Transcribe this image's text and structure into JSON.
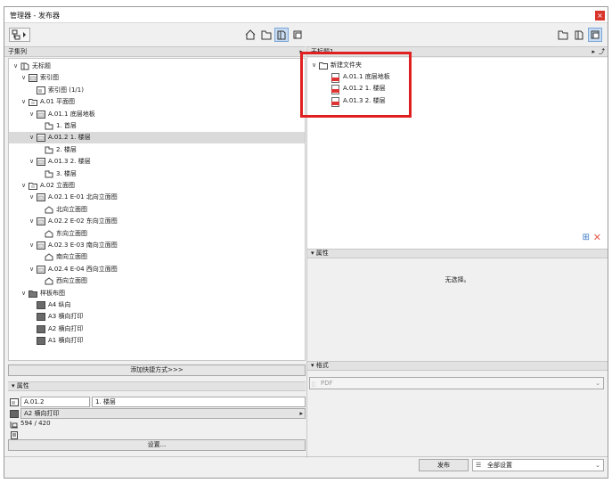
{
  "window": {
    "title": "管理器 - 发布器",
    "close_label": "×"
  },
  "left_panel": {
    "header": "子集列",
    "tree": [
      {
        "label": "无标题",
        "indent": 0,
        "chev": "∨",
        "icon": "book-icon",
        "selected": false
      },
      {
        "label": "索引图",
        "indent": 1,
        "chev": "∨",
        "icon": "view-icon",
        "selected": false
      },
      {
        "label": "索引图 (1/1)",
        "indent": 2,
        "chev": "",
        "icon": "layout-icon",
        "selected": false
      },
      {
        "label": "A.01 平面图",
        "indent": 1,
        "chev": "∨",
        "icon": "folder-view-icon",
        "selected": false
      },
      {
        "label": "A.01.1 底层地板",
        "indent": 2,
        "chev": "∨",
        "icon": "view-icon",
        "selected": false
      },
      {
        "label": "1. 首层",
        "indent": 3,
        "chev": "",
        "icon": "plan-icon",
        "selected": false
      },
      {
        "label": "A.01.2 1. 楼层",
        "indent": 2,
        "chev": "∨",
        "icon": "view-icon",
        "selected": true
      },
      {
        "label": "2. 楼层",
        "indent": 3,
        "chev": "",
        "icon": "plan-icon",
        "selected": false
      },
      {
        "label": "A.01.3 2. 楼层",
        "indent": 2,
        "chev": "∨",
        "icon": "view-icon",
        "selected": false
      },
      {
        "label": "3. 楼层",
        "indent": 3,
        "chev": "",
        "icon": "plan-icon",
        "selected": false
      },
      {
        "label": "A.02 立面图",
        "indent": 1,
        "chev": "∨",
        "icon": "folder-view-icon",
        "selected": false
      },
      {
        "label": "A.02.1 E-01 北向立面图",
        "indent": 2,
        "chev": "∨",
        "icon": "view-icon",
        "selected": false
      },
      {
        "label": "北向立面图",
        "indent": 3,
        "chev": "",
        "icon": "elevation-icon",
        "selected": false
      },
      {
        "label": "A.02.2 E-02 东向立面图",
        "indent": 2,
        "chev": "∨",
        "icon": "view-icon",
        "selected": false
      },
      {
        "label": "东向立面图",
        "indent": 3,
        "chev": "",
        "icon": "elevation-icon",
        "selected": false
      },
      {
        "label": "A.02.3 E-03 南向立面图",
        "indent": 2,
        "chev": "∨",
        "icon": "view-icon",
        "selected": false
      },
      {
        "label": "南向立面图",
        "indent": 3,
        "chev": "",
        "icon": "elevation-icon",
        "selected": false
      },
      {
        "label": "A.02.4 E-04 西向立面图",
        "indent": 2,
        "chev": "∨",
        "icon": "view-icon",
        "selected": false
      },
      {
        "label": "西向立面图",
        "indent": 3,
        "chev": "",
        "icon": "elevation-icon",
        "selected": false
      },
      {
        "label": "样板布图",
        "indent": 1,
        "chev": "∨",
        "icon": "folder-dark-icon",
        "selected": false
      },
      {
        "label": "A4 纵向",
        "indent": 2,
        "chev": "",
        "icon": "sheet-dark-icon",
        "selected": false
      },
      {
        "label": "A3 横向打印",
        "indent": 2,
        "chev": "",
        "icon": "sheet-dark-icon",
        "selected": false
      },
      {
        "label": "A2 横向打印",
        "indent": 2,
        "chev": "",
        "icon": "sheet-dark-icon",
        "selected": false
      },
      {
        "label": "A1 横向打印",
        "indent": 2,
        "chev": "",
        "icon": "sheet-dark-icon",
        "selected": false
      }
    ],
    "add_shortcut_label": "添加快捷方式>>>",
    "properties_header": "属性",
    "id_value": "A.01.2",
    "name_value": "1. 楼层",
    "master_value": "A2 横向打印",
    "size_value": "594 / 420",
    "settings_label": "设置..."
  },
  "right_panel": {
    "header": "无标题1",
    "tree": [
      {
        "label": "新建文件夹",
        "indent": 0,
        "chev": "∨",
        "icon": "folder-icon"
      },
      {
        "label": "A.01.1 底层地板",
        "indent": 1,
        "chev": "",
        "icon": "pdf-icon"
      },
      {
        "label": "A.01.2 1. 楼层",
        "indent": 1,
        "chev": "",
        "icon": "pdf-icon"
      },
      {
        "label": "A.01.3 2. 楼层",
        "indent": 1,
        "chev": "",
        "icon": "pdf-icon"
      }
    ],
    "properties_header": "属性",
    "no_selection_text": "无选择。",
    "format_header": "格式",
    "format_value": "PDF"
  },
  "footer": {
    "publish_label": "发布",
    "scope_value": "全部设置"
  },
  "colors": {
    "highlight": "#e02020",
    "selected_tool": "#c7dcf3"
  }
}
